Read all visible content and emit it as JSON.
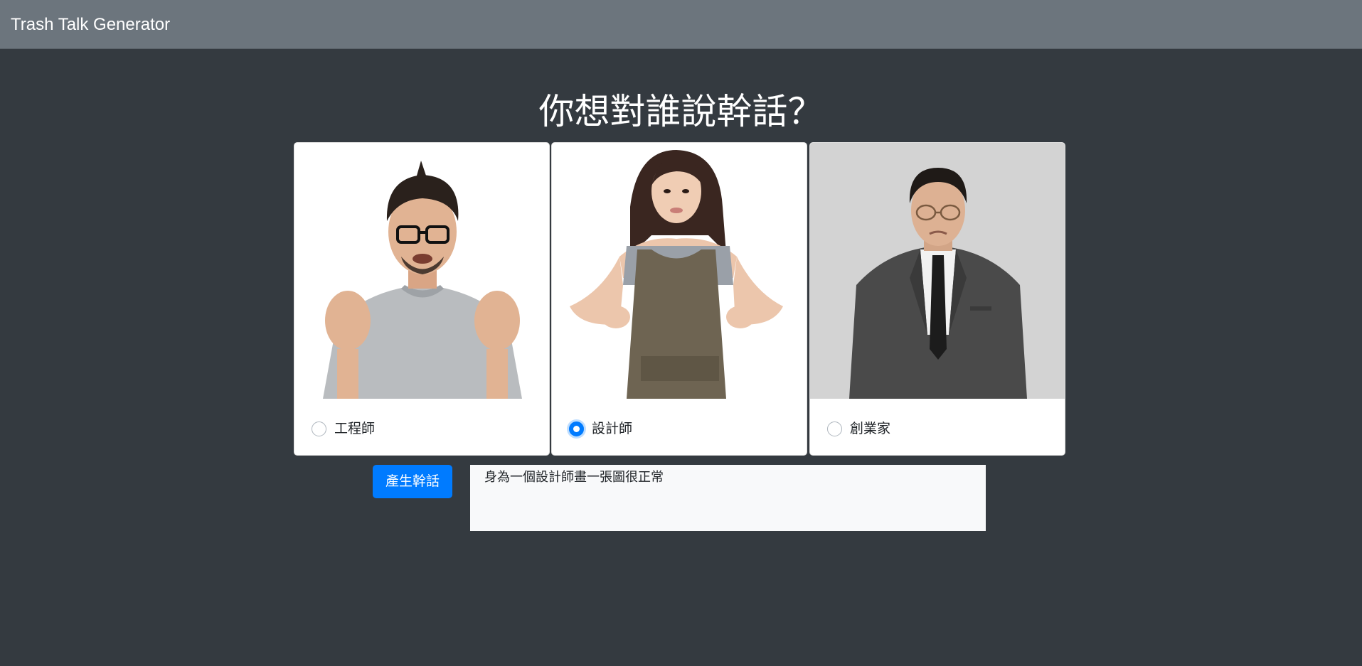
{
  "navbar": {
    "brand": "Trash Talk Generator"
  },
  "main": {
    "title": "你想對誰說幹話？",
    "targets": [
      {
        "label": "工程師",
        "checked": false
      },
      {
        "label": "設計師",
        "checked": true
      },
      {
        "label": "創業家",
        "checked": false
      }
    ],
    "generate_button": "產生幹話",
    "output_text": "身為一個設計師畫一張圖很正常"
  },
  "colors": {
    "page_bg": "#343a40",
    "navbar_bg": "#6c757d",
    "primary": "#007bff"
  }
}
